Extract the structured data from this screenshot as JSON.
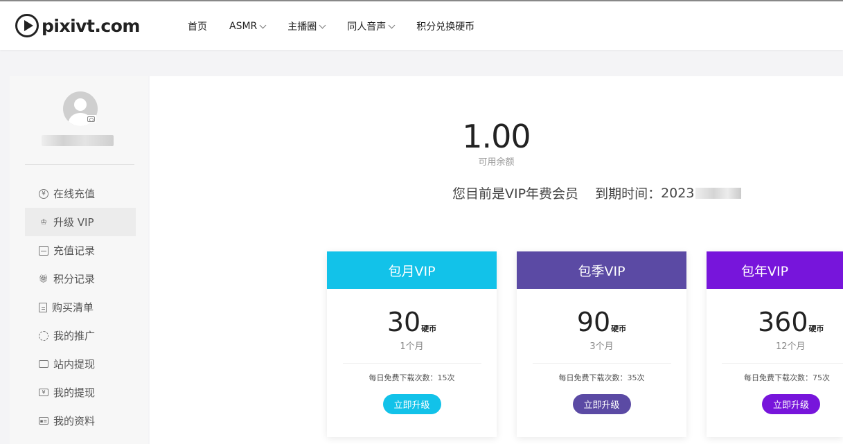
{
  "header": {
    "logo_text": "pixivt.com",
    "nav": [
      {
        "label": "首页",
        "has_dropdown": false
      },
      {
        "label": "ASMR",
        "has_dropdown": true
      },
      {
        "label": "主播圈",
        "has_dropdown": true
      },
      {
        "label": "同人音声",
        "has_dropdown": true
      },
      {
        "label": "积分兑换硬币",
        "has_dropdown": false
      }
    ]
  },
  "sidebar": {
    "menu": [
      {
        "label": "在线充值",
        "icon": "yen-circle-icon",
        "active": false
      },
      {
        "label": "升级 VIP",
        "icon": "crown-icon",
        "active": true
      },
      {
        "label": "充值记录",
        "icon": "wallet-icon",
        "active": false
      },
      {
        "label": "积分记录",
        "icon": "gift-icon",
        "active": false
      },
      {
        "label": "购买清单",
        "icon": "receipt-icon",
        "active": false
      },
      {
        "label": "我的推广",
        "icon": "share-icon",
        "active": false
      },
      {
        "label": "站内提现",
        "icon": "ticket-icon",
        "active": false
      },
      {
        "label": "我的提现",
        "icon": "yen-card-icon",
        "active": false
      },
      {
        "label": "我的资料",
        "icon": "id-card-icon",
        "active": false
      }
    ]
  },
  "main": {
    "balance": "1.00",
    "balance_label": "可用余额",
    "status_text": "您目前是VIP年费会员",
    "expiry_label": "到期时间：",
    "expiry_value": "2023",
    "plans": [
      {
        "title": "包月VIP",
        "price": "30",
        "unit": "硬币",
        "period": "1个月",
        "downloads": "每日免费下载次数：15次",
        "button": "立即升级",
        "color": "#12c2e9"
      },
      {
        "title": "包季VIP",
        "price": "90",
        "unit": "硬币",
        "period": "3个月",
        "downloads": "每日免费下载次数：35次",
        "button": "立即升级",
        "color": "#5b4aa4"
      },
      {
        "title": "包年VIP",
        "price": "360",
        "unit": "硬币",
        "period": "12个月",
        "downloads": "每日免费下载次数：75次",
        "button": "立即升级",
        "color": "#7715db"
      }
    ]
  }
}
